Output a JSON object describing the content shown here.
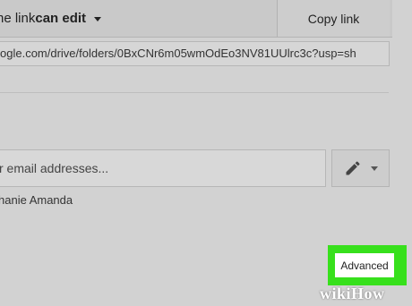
{
  "share": {
    "link_access_prefix": "ne link ",
    "link_access_bold": "can edit",
    "copy_link_label": "Copy link",
    "share_url": "ogle.com/drive/folders/0BxCNr6m05wmOdEo3NV81UUlrc3c?usp=sh"
  },
  "people": {
    "email_placeholder": "r email addresses...",
    "owner_name": "hanie Amanda"
  },
  "advanced_label": "Advanced",
  "watermark": {
    "wiki": "wiki",
    "how": "How"
  },
  "colors": {
    "highlight": "#37e01c",
    "background": "#d2d2d2"
  },
  "icons": {
    "dropdown": "caret-down-icon",
    "edit": "pencil-icon"
  }
}
